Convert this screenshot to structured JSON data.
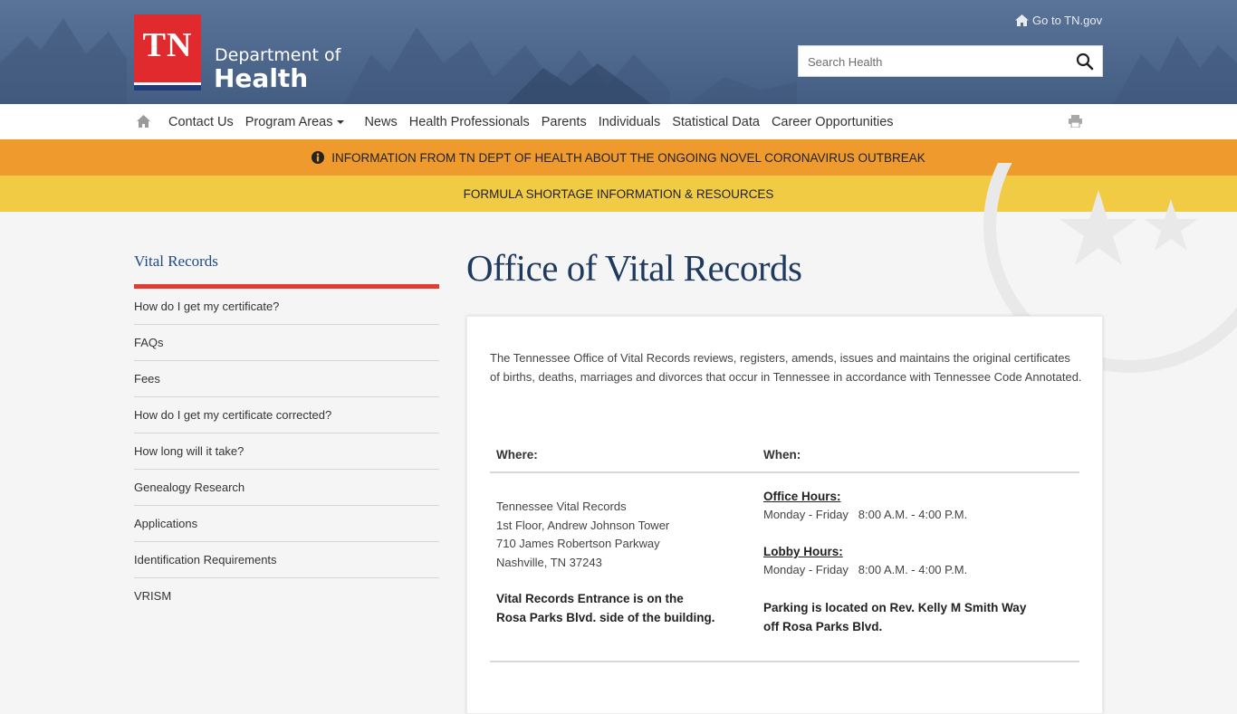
{
  "header": {
    "logo_text": "TN",
    "dept_line1": "Department of",
    "dept_line2": "Health",
    "goto_link": "Go to TN.gov",
    "search_placeholder": "Search Health"
  },
  "nav": {
    "items": [
      {
        "label": "Contact Us"
      },
      {
        "label": "Program Areas"
      },
      {
        "label": "News"
      },
      {
        "label": "Health Professionals"
      },
      {
        "label": "Parents"
      },
      {
        "label": "Individuals"
      },
      {
        "label": "Statistical Data"
      },
      {
        "label": "Career Opportunities"
      }
    ]
  },
  "alerts": {
    "covid": "INFORMATION FROM TN DEPT OF HEALTH ABOUT THE ONGOING NOVEL CORONAVIRUS OUTBREAK",
    "formula": "FORMULA SHORTAGE INFORMATION & RESOURCES"
  },
  "sidebar": {
    "title": "Vital Records",
    "items": [
      {
        "label": "How do I get my certificate?"
      },
      {
        "label": "FAQs"
      },
      {
        "label": "Fees"
      },
      {
        "label": "How do I get my certificate corrected?"
      },
      {
        "label": "How long will it take?"
      },
      {
        "label": "Genealogy Research"
      },
      {
        "label": "Applications"
      },
      {
        "label": "Identification Requirements"
      },
      {
        "label": "VRISM"
      }
    ]
  },
  "main": {
    "title": "Office of Vital Records",
    "intro": "The Tennessee Office of Vital Records reviews, registers, amends, issues and maintains the original certificates of births, deaths, marriages and divorces that occur in Tennessee in accordance with Tennessee Code Annotated.",
    "where_label": "Where:",
    "when_label": "When:",
    "address": [
      "Tennessee Vital Records",
      "1st Floor, Andrew Johnson Tower",
      "710 James Robertson Parkway",
      "Nashville, TN  37243"
    ],
    "entrance_note": [
      "Vital Records Entrance is on the",
      "Rosa Parks Blvd. side of the building."
    ],
    "office_hours_label": "Office Hours:",
    "office_hours": "Monday - Friday   8:00 A.M. - 4:00 P.M.",
    "lobby_hours_label": "Lobby Hours:",
    "lobby_hours": "Monday - Friday   8:00 A.M. - 4:00 P.M.",
    "parking_note": [
      "Parking is located on Rev. Kelly M Smith Way",
      "off Rosa Parks Blvd."
    ]
  }
}
